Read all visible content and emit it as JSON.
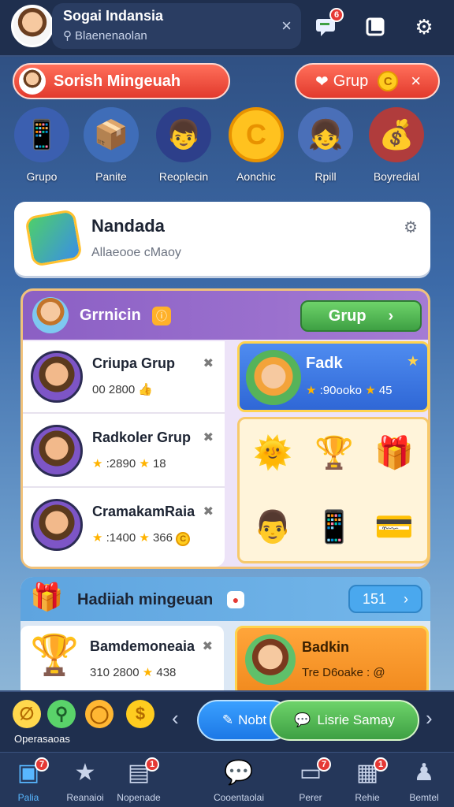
{
  "header": {
    "title": "Sogai Indansia",
    "search_placeholder": "Blaenenaolan",
    "close_glyph": "×",
    "chat_badge": "6"
  },
  "quick_actions": {
    "left_label": "Sorish Mingeuah",
    "right_label": "Grup",
    "right_close": "×"
  },
  "categories": [
    {
      "label": "Grupo",
      "icon": "phone-card-icon"
    },
    {
      "label": "Panite",
      "icon": "boxes-icon"
    },
    {
      "label": "Reoplecin",
      "icon": "boy-avatar-icon"
    },
    {
      "label": "Aonchic",
      "icon": "coin-icon"
    },
    {
      "label": "Rpill",
      "icon": "girl-avatar-icon"
    },
    {
      "label": "Boyredial",
      "icon": "coin-bag-icon"
    }
  ],
  "info_card": {
    "title": "Nandada",
    "subtitle": "Allaeooe cMaoy"
  },
  "group_panel": {
    "title": "Grrnicin",
    "button_label": "Grup",
    "items": [
      {
        "name": "Criupa Grup",
        "value": "00 2800"
      },
      {
        "name": "Radkoler Grup",
        "value": "2890"
      },
      {
        "name": "CramakamRaia",
        "value": "1400"
      }
    ],
    "featured": {
      "name": "Fadk",
      "value": "90ooko",
      "extra": "45"
    },
    "item_extra": [
      "",
      "18",
      "366"
    ]
  },
  "reward_panel": {
    "title": "Hadiiah mingeuan",
    "button_label": "151",
    "left": {
      "name": "Bamdemoneaia",
      "value": "310 2800",
      "extra": "438"
    },
    "right": {
      "name": "Badkin",
      "value": "Tre D6oake : @"
    }
  },
  "dock": {
    "label": "Operasaoas",
    "next_label": "Nobt",
    "share_label": "Lisrie Samay"
  },
  "tabs": [
    {
      "label": "Palia",
      "badge": "7"
    },
    {
      "label": "Reanaioi",
      "badge": ""
    },
    {
      "label": "Nopenade",
      "badge": "1"
    },
    {
      "label": "Cooentaolai",
      "badge": ""
    },
    {
      "label": "Perer",
      "badge": "7"
    },
    {
      "label": "Rehie",
      "badge": "1"
    },
    {
      "label": "Bemtel",
      "badge": ""
    }
  ],
  "colors": {
    "accent_red": "#e23a2d",
    "accent_green": "#3ea043",
    "accent_blue": "#1c78e6",
    "panel_purple": "#8b5fc4"
  }
}
